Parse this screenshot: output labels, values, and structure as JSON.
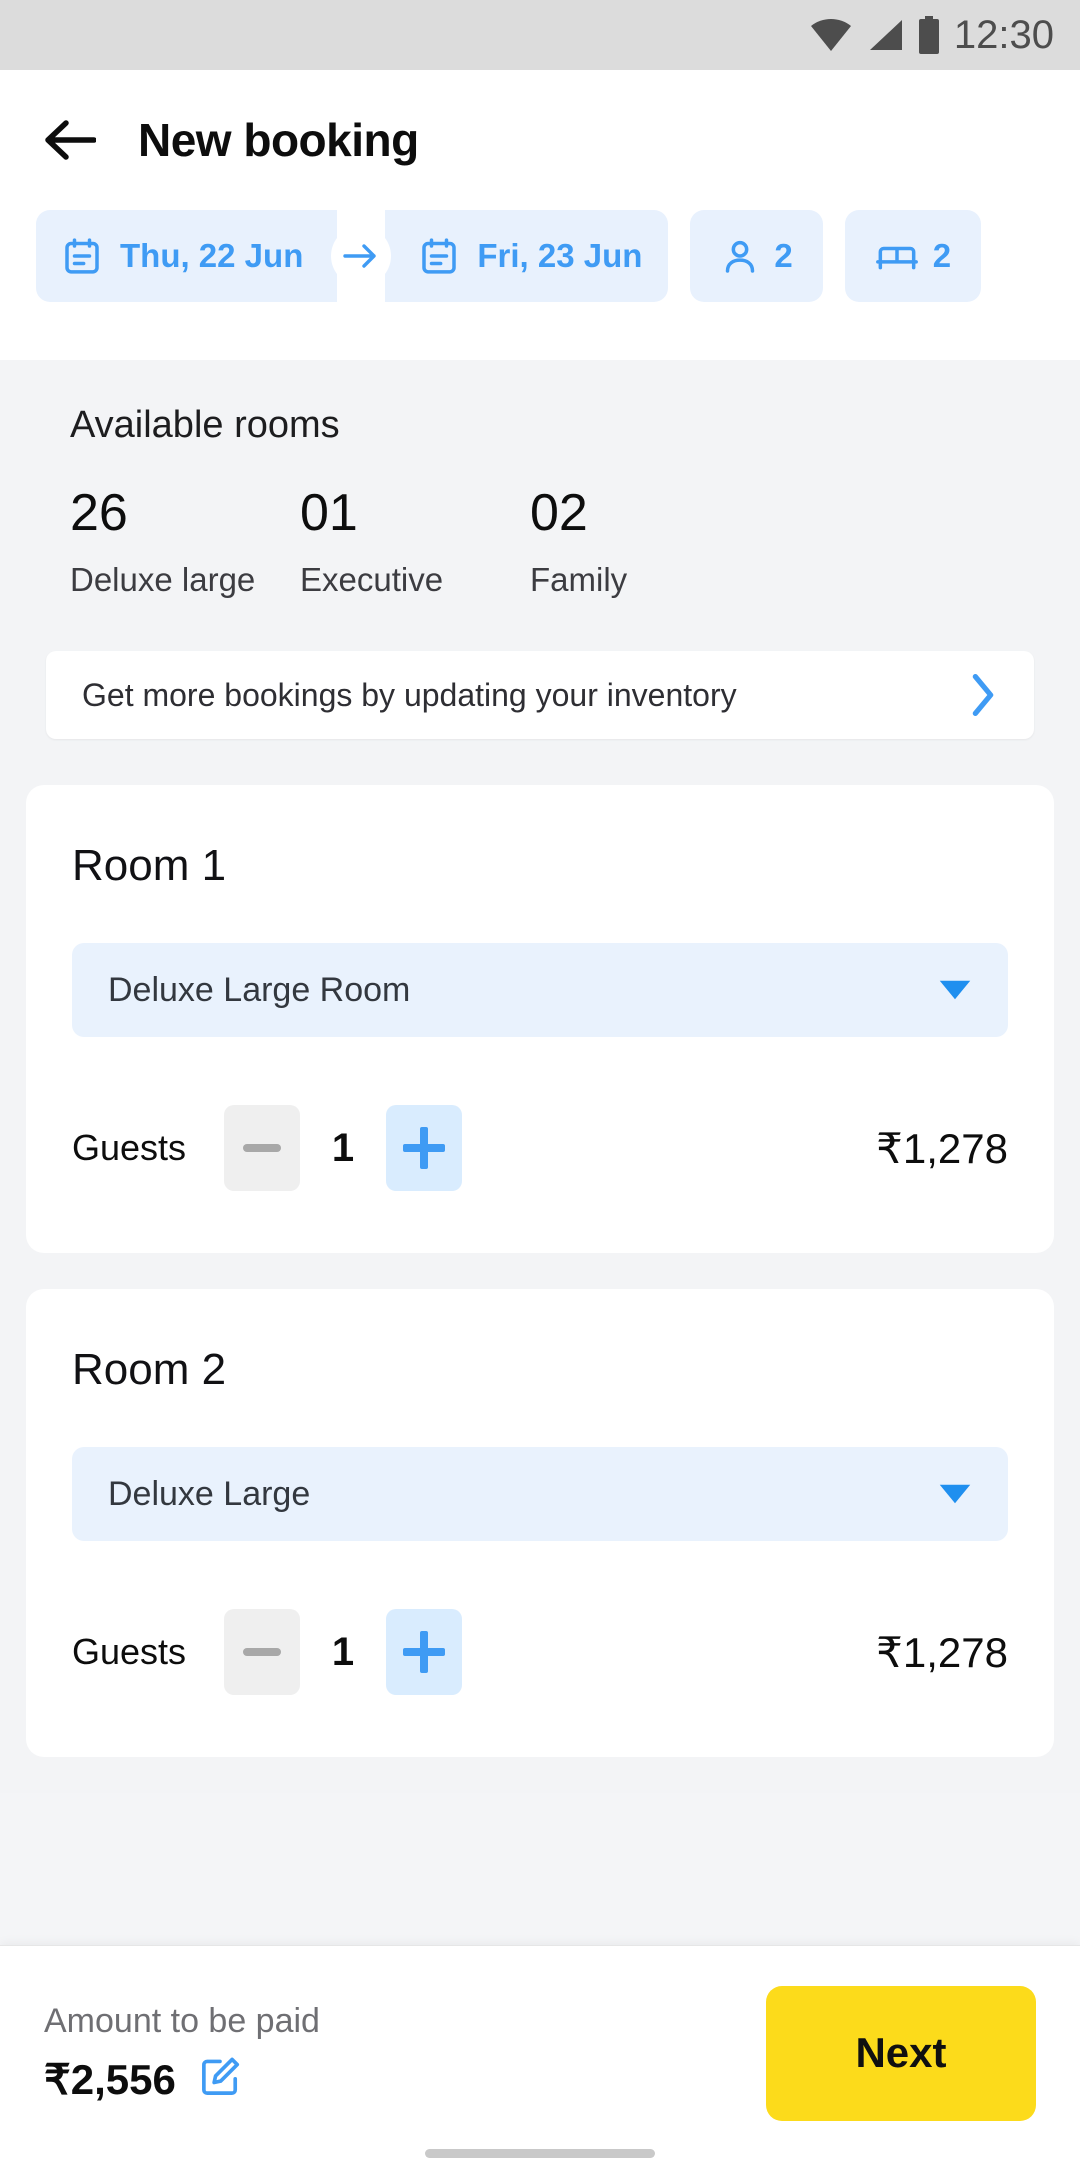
{
  "status_bar": {
    "time": "12:30",
    "icons": [
      "wifi-icon",
      "signal-icon",
      "battery-icon"
    ]
  },
  "appbar": {
    "title": "New booking",
    "back_icon": "back-arrow-icon"
  },
  "filters": {
    "check_in": {
      "label": "Thu, 22 Jun",
      "icon": "calendar-icon"
    },
    "check_out": {
      "label": "Fri, 23 Jun",
      "icon": "calendar-icon"
    },
    "range_arrow_icon": "arrow-right-icon",
    "guests": {
      "value": "2",
      "icon": "person-icon"
    },
    "rooms": {
      "value": "2",
      "icon": "bed-icon"
    }
  },
  "available_rooms": {
    "title": "Available rooms",
    "stats": [
      {
        "count": "26",
        "label": "Deluxe large"
      },
      {
        "count": "01",
        "label": "Executive"
      },
      {
        "count": "02",
        "label": "Family"
      }
    ]
  },
  "inventory_banner": {
    "text": "Get more bookings by updating your inventory",
    "chevron_icon": "chevron-right-icon"
  },
  "rooms": [
    {
      "title": "Room 1",
      "room_type": "Deluxe Large Room",
      "dropdown_icon": "caret-down-icon",
      "guests_label": "Guests",
      "guests_count": "1",
      "minus_icon": "minus-icon",
      "plus_icon": "plus-icon",
      "price": "₹1,278"
    },
    {
      "title": "Room 2",
      "room_type": "Deluxe Large",
      "dropdown_icon": "caret-down-icon",
      "guests_label": "Guests",
      "guests_count": "1",
      "minus_icon": "minus-icon",
      "plus_icon": "plus-icon",
      "price": "₹1,278"
    }
  ],
  "bottom_bar": {
    "amount_label": "Amount to be paid",
    "amount_value": "₹2,556",
    "edit_icon": "edit-pencil-icon",
    "next_label": "Next"
  },
  "colors": {
    "accent_blue": "#3f9bf4",
    "chip_bg": "#e8f1fd",
    "next_yellow": "#fcdb1b",
    "page_bg": "#f3f4f6"
  }
}
